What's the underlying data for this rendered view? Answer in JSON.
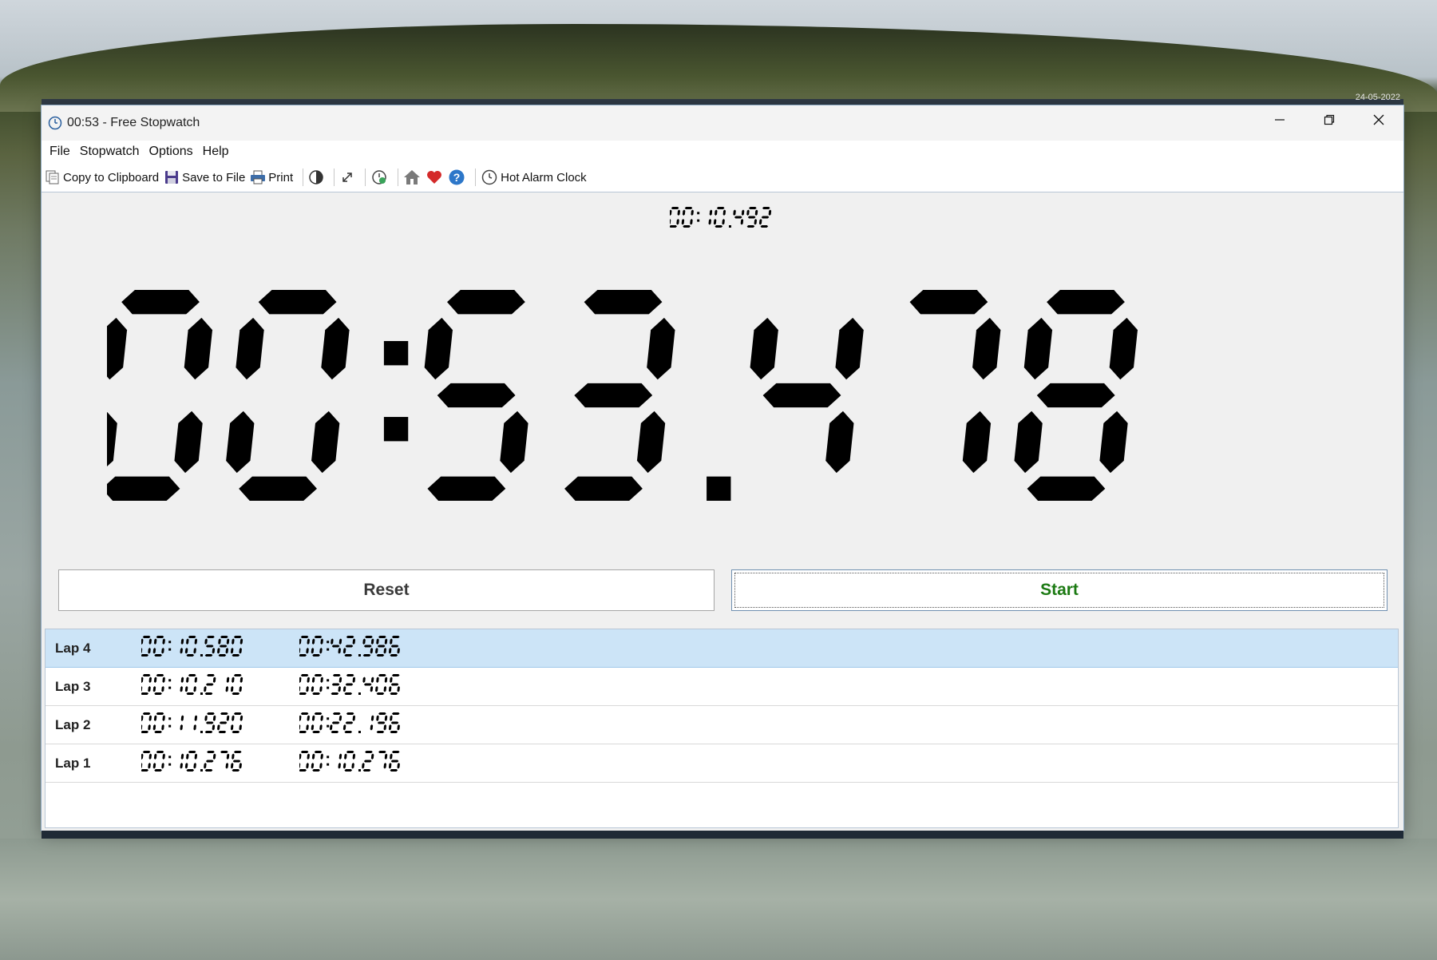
{
  "window": {
    "title": "00:53 - Free Stopwatch"
  },
  "desktop": {
    "date": "24-05-2022"
  },
  "menu": [
    "File",
    "Stopwatch",
    "Options",
    "Help"
  ],
  "toolbar": {
    "copy_label": "Copy to Clipboard",
    "save_label": "Save to File",
    "print_label": "Print",
    "alarm_label": "Hot Alarm Clock",
    "icons": [
      "copy-icon",
      "save-icon",
      "print-icon",
      "contrast-icon",
      "fullscreen-icon",
      "clock-refresh-icon",
      "home-icon",
      "heart-icon",
      "help-icon",
      "alarm-clock-icon"
    ]
  },
  "display": {
    "current_lap": "00:10.492",
    "main_time": "00:53.478"
  },
  "buttons": {
    "reset": "Reset",
    "start": "Start"
  },
  "laps": [
    {
      "name": "Lap 4",
      "split": "00:10.580",
      "total": "00:42.986",
      "selected": true
    },
    {
      "name": "Lap 3",
      "split": "00:10.210",
      "total": "00:32.406",
      "selected": false
    },
    {
      "name": "Lap 2",
      "split": "00:11.920",
      "total": "00:22.196",
      "selected": false
    },
    {
      "name": "Lap 1",
      "split": "00:10.276",
      "total": "00:10.276",
      "selected": false
    }
  ],
  "colors": {
    "start_text": "#1c7a13",
    "selected_row": "#cce4f7",
    "digit": "#000000"
  }
}
